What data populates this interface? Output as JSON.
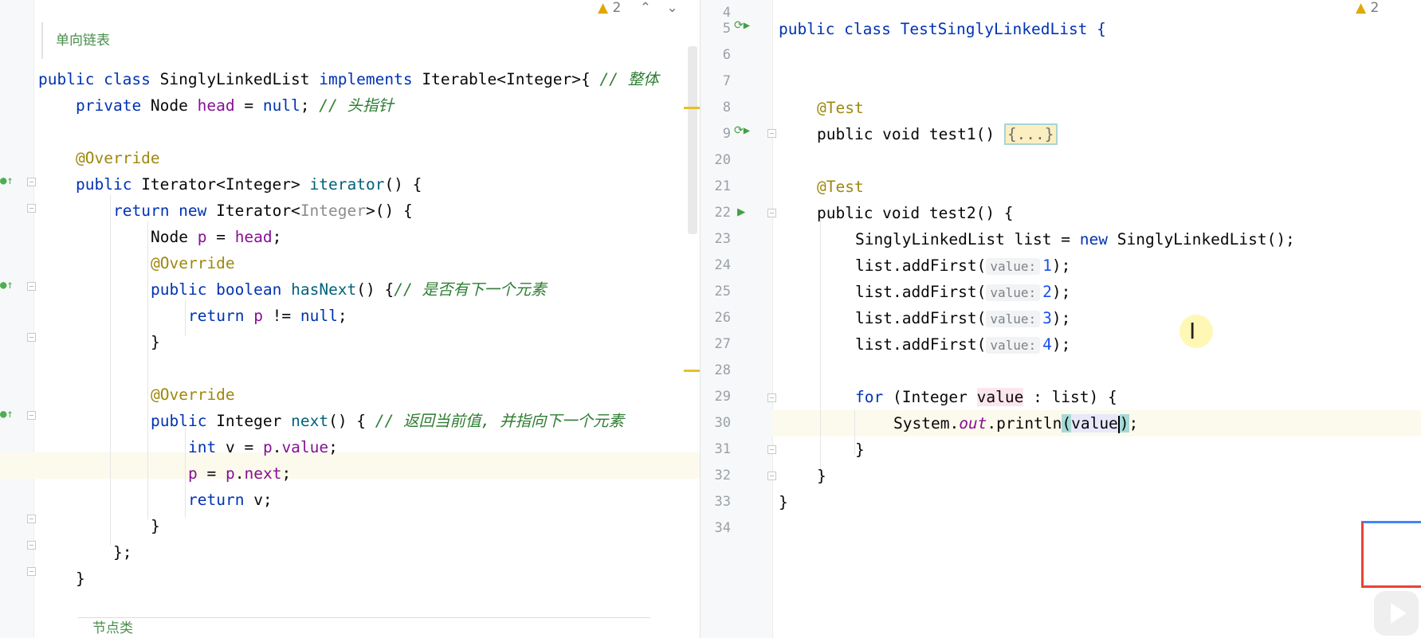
{
  "left_editor": {
    "doc_comment": "单向链表",
    "warnings_count": "2",
    "lines": [
      {
        "parts": [
          [
            "kw",
            "public class "
          ],
          [
            "type",
            "SinglyLinkedList "
          ],
          [
            "kw",
            "implements "
          ],
          [
            "type",
            "Iterable<Integer>{ "
          ],
          [
            "comg",
            "// 整体"
          ]
        ]
      },
      {
        "parts": [
          [
            "kw",
            "private "
          ],
          [
            "type",
            "Node "
          ],
          [
            "field",
            "head"
          ],
          [
            "type",
            " = "
          ],
          [
            "kw",
            "null"
          ],
          [
            "type",
            "; "
          ],
          [
            "comg",
            "// 头指针"
          ]
        ]
      },
      {
        "parts": []
      },
      {
        "parts": [
          [
            "ann",
            "@Override"
          ]
        ]
      },
      {
        "parts": [
          [
            "kw",
            "public "
          ],
          [
            "type",
            "Iterator<Integer> "
          ],
          [
            "fn",
            "iterator"
          ],
          [
            "type",
            "() {"
          ]
        ]
      },
      {
        "parts": [
          [
            "kw",
            "return new "
          ],
          [
            "type",
            "Iterator<"
          ],
          [
            "gray",
            "Integer"
          ],
          [
            "type",
            ">() {"
          ]
        ]
      },
      {
        "parts": [
          [
            "type",
            "Node "
          ],
          [
            "field",
            "p"
          ],
          [
            "type",
            " = "
          ],
          [
            "field",
            "head"
          ],
          [
            "type",
            ";"
          ]
        ]
      },
      {
        "parts": [
          [
            "ann",
            "@Override"
          ]
        ]
      },
      {
        "parts": [
          [
            "kw",
            "public boolean "
          ],
          [
            "fn",
            "hasNext"
          ],
          [
            "type",
            "() {"
          ],
          [
            "comg",
            "// 是否有下一个元素"
          ]
        ]
      },
      {
        "parts": [
          [
            "kw",
            "return "
          ],
          [
            "field",
            "p"
          ],
          [
            "type",
            " != "
          ],
          [
            "kw",
            "null"
          ],
          [
            "type",
            ";"
          ]
        ]
      },
      {
        "parts": [
          [
            "type",
            "}"
          ]
        ]
      },
      {
        "parts": []
      },
      {
        "parts": [
          [
            "ann",
            "@Override"
          ]
        ]
      },
      {
        "parts": [
          [
            "kw",
            "public "
          ],
          [
            "type",
            "Integer "
          ],
          [
            "fn",
            "next"
          ],
          [
            "type",
            "() { "
          ],
          [
            "comg",
            "// 返回当前值, 并指向下一个元素"
          ]
        ]
      },
      {
        "parts": [
          [
            "kw",
            "int "
          ],
          [
            "type",
            "v = "
          ],
          [
            "field",
            "p"
          ],
          [
            "type",
            "."
          ],
          [
            "field",
            "value"
          ],
          [
            "type",
            ";"
          ]
        ]
      },
      {
        "parts": [
          [
            "field",
            "p"
          ],
          [
            "type",
            " = "
          ],
          [
            "field",
            "p"
          ],
          [
            "type",
            "."
          ],
          [
            "field",
            "next"
          ],
          [
            "type",
            ";"
          ]
        ]
      },
      {
        "parts": [
          [
            "kw",
            "return "
          ],
          [
            "type",
            "v;"
          ]
        ]
      },
      {
        "parts": [
          [
            "type",
            "}"
          ]
        ]
      },
      {
        "parts": [
          [
            "type",
            "};"
          ]
        ]
      },
      {
        "parts": [
          [
            "type",
            "}"
          ]
        ]
      }
    ],
    "bottom_comment": "节点类"
  },
  "right_editor": {
    "warnings_count": "2",
    "line_numbers": [
      "4",
      "5",
      "6",
      "7",
      "8",
      "9",
      "20",
      "21",
      "22",
      "23",
      "24",
      "25",
      "26",
      "27",
      "28",
      "29",
      "30",
      "31",
      "32",
      "33",
      "34"
    ],
    "code": {
      "l5": "public class TestSinglyLinkedList {",
      "l8": "@Test",
      "l9": "public void test1() ",
      "l9_fold": "{...}",
      "l21": "@Test",
      "l22": "public void test2() {",
      "l23_a": "SinglyLinkedList list = ",
      "l23_kw": "new",
      "l23_b": " SinglyLinkedList();",
      "add_call": "list.addFirst(",
      "hint_label": "value:",
      "add_values": [
        "1",
        "2",
        "3",
        "4"
      ],
      "add_end": ");",
      "l29_for": "for",
      "l29_a": " (Integer ",
      "l29_value": "value",
      "l29_b": " : list) {",
      "l30_a": "System.",
      "l30_out": "out",
      "l30_b": ".println",
      "l30_paren": "(",
      "l30_value": "value",
      "l30_close": ")",
      "l30_end": ";",
      "close_inner": "}",
      "close_method": "}",
      "close_class": "}"
    }
  },
  "overlay": {
    "cursor_glyph": "I",
    "warning_icon": "warning-triangle-icon",
    "accent_color": "#0033b3"
  }
}
